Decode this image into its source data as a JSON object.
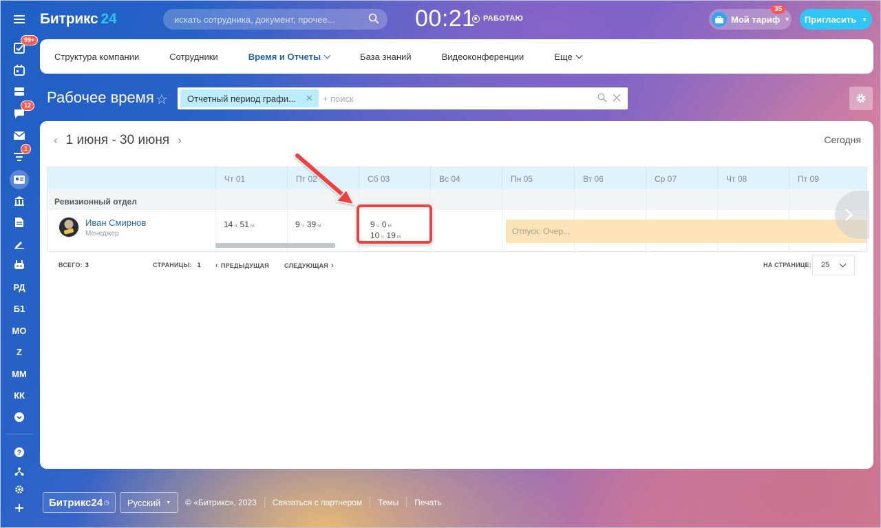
{
  "sidebar": {
    "badges": {
      "tasks": "99+",
      "chat": "12",
      "feed": "1"
    },
    "text_items": [
      "РД",
      "Б1",
      "МО",
      "Z",
      "ММ",
      "КК"
    ]
  },
  "header": {
    "logo_text": "Битрикс",
    "logo_num": "24",
    "search_placeholder": "искать сотрудника, документ, прочее...",
    "clock": "00:21",
    "work_status": "РАБОТАЮ",
    "tariff_label": "Мой тариф",
    "tariff_badge": "35",
    "invite_label": "Пригласить"
  },
  "nav": {
    "items": [
      "Структура компании",
      "Сотрудники",
      "Время и Отчеты",
      "База знаний",
      "Видеоконференции",
      "Еще"
    ]
  },
  "page": {
    "title": "Рабочее время",
    "filter_chip": "Отчетный период графи...",
    "filter_placeholder": "+ поиск"
  },
  "report": {
    "period": "1 июня - 30 июня",
    "today_label": "Сегодня",
    "days": [
      "Чт 01",
      "Пт 02",
      "Сб 03",
      "Вс 04",
      "Пн 05",
      "Вт 06",
      "Ср 07",
      "Чт 08",
      "Пт 09"
    ],
    "department": "Ревизионный отдел",
    "employee": {
      "name": "Иван Смирнов",
      "role": "Менеджер"
    },
    "cells": {
      "d1_h": "14",
      "d1_m": "51",
      "d2_h": "9",
      "d2_m": "39",
      "d3a_h": "9",
      "d3a_m": "0",
      "d3b_h": "10",
      "d3b_m": "19",
      "unit_h": "ч",
      "unit_m": "м"
    },
    "vacation": "Отпуск: Очер..."
  },
  "pagination": {
    "total_label": "ВСЕГО:",
    "total": "3",
    "pages_label": "СТРАНИЦЫ:",
    "pages": "1",
    "prev": "ПРЕДЫДУЩАЯ",
    "next": "СЛЕДУЮЩАЯ",
    "per_page_label": "НА СТРАНИЦЕ:",
    "per_page": "25"
  },
  "footer": {
    "brand": "Битрикс24",
    "language": "Русский",
    "copyright": "© «Битрикс», 2023",
    "links": [
      "Связаться с партнером",
      "Темы",
      "Печать"
    ]
  },
  "colors": {
    "accent": "#2fc6f6",
    "link": "#2066b0",
    "highlight": "#ef3f3f",
    "vacation": "#fde4b8"
  }
}
